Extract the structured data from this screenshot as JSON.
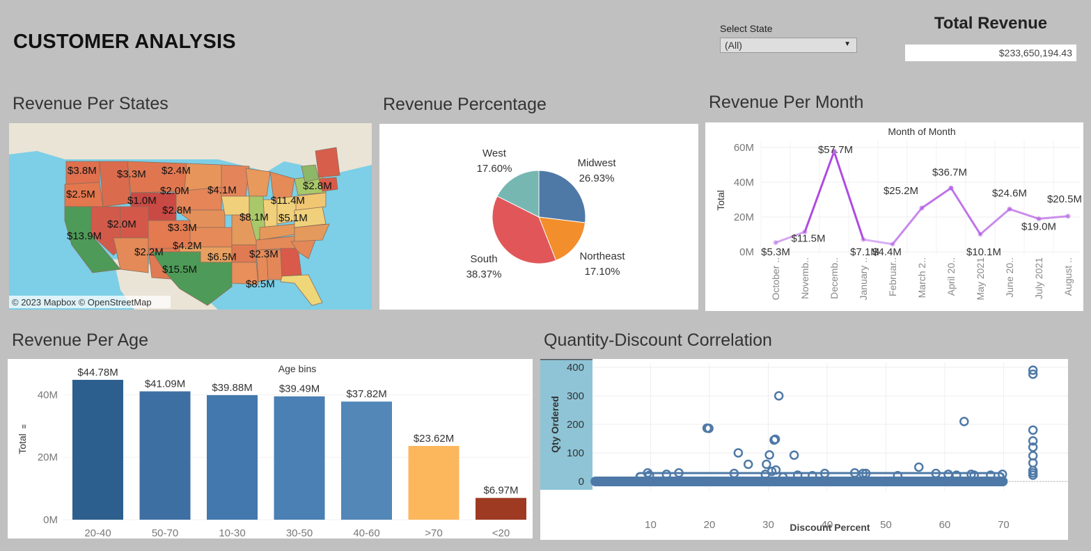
{
  "header": {
    "title": "CUSTOMER ANALYSIS"
  },
  "filter": {
    "label": "Select State",
    "value": "(All)"
  },
  "kpi": {
    "title": "Total Revenue",
    "value": "$233,650,194.43"
  },
  "sections": {
    "states": "Revenue Per States",
    "percentage": "Revenue Percentage",
    "month": "Revenue Per Month",
    "age": "Revenue Per Age",
    "discount": "Quantity-Discount Correlation"
  },
  "map": {
    "attribution": "© 2023 Mapbox  © OpenStreetMap",
    "labels": [
      "$3.8M",
      "$3.3M",
      "$2.4M",
      "$2.5M",
      "$2.0M",
      "$1.0M",
      "$4.1M",
      "$2.8M",
      "$2.8M",
      "$11.4M",
      "$2.0M",
      "$3.3M",
      "$8.1M",
      "$5.1M",
      "$13.9M",
      "$4.2M",
      "$2.2M",
      "$6.5M",
      "$2.3M",
      "$15.5M",
      "$8.5M"
    ],
    "colors": {
      "high": "#4e9a58",
      "mid": "#efd679",
      "low": "#d9574a"
    }
  },
  "chart_data": [
    {
      "type": "pie",
      "labels": [
        "Midwest",
        "Northeast",
        "South",
        "West"
      ],
      "values": [
        26.93,
        17.1,
        38.37,
        17.6
      ],
      "value_labels": [
        "26.93%",
        "17.10%",
        "38.37%",
        "17.60%"
      ],
      "colors": [
        "#4e79a7",
        "#f28e2b",
        "#e15759",
        "#76b7b2"
      ]
    },
    {
      "type": "line",
      "title": "Month of Month",
      "ylabel": "Total",
      "categories": [
        "October ..",
        "Novemb..",
        "Decemb..",
        "January ..",
        "Februar..",
        "March 2..",
        "April 20..",
        "May 2021",
        "June 20..",
        "July 2021",
        "August .."
      ],
      "values": [
        5.3,
        11.5,
        57.7,
        7.1,
        4.4,
        25.2,
        36.7,
        10.1,
        24.6,
        19.0,
        20.5
      ],
      "value_labels": [
        "$5.3M",
        "$11.5M",
        "$57.7M",
        "$7.1M",
        "$4.4M",
        "$25.2M",
        "$36.7M",
        "$10.1M",
        "$24.6M",
        "$19.0M",
        "$20.5M"
      ],
      "ylim": [
        0,
        60
      ],
      "yticks": [
        "0M",
        "20M",
        "40M",
        "60M"
      ],
      "grid": true
    },
    {
      "type": "bar",
      "title": "Age bins",
      "ylabel": "Total",
      "categories": [
        "20-40",
        "50-70",
        "10-30",
        "30-50",
        "40-60",
        ">70",
        "<20"
      ],
      "values": [
        44.78,
        41.09,
        39.88,
        39.49,
        37.82,
        23.62,
        6.97
      ],
      "value_labels": [
        "$44.78M",
        "$41.09M",
        "$39.88M",
        "$39.49M",
        "$37.82M",
        "$23.62M",
        "$6.97M"
      ],
      "colors": [
        "#2d5f8e",
        "#3d6fa2",
        "#4278ad",
        "#4a80b4",
        "#5287b8",
        "#fcb75c",
        "#9e3a22"
      ],
      "ylim": [
        0,
        47
      ],
      "yticks": [
        "0M",
        "20M",
        "40M"
      ]
    },
    {
      "type": "scatter",
      "xlabel": "Discount Percent",
      "ylabel": "Qty Ordered",
      "xlim": [
        0,
        78
      ],
      "ylim": [
        -10,
        410
      ],
      "xticks": [
        "10",
        "20",
        "30",
        "40",
        "50",
        "60",
        "70"
      ],
      "yticks": [
        "0",
        "100",
        "200",
        "300",
        "400"
      ],
      "points": [
        [
          9.5,
          30
        ],
        [
          9.8,
          22
        ],
        [
          12.7,
          25
        ],
        [
          14.8,
          30
        ],
        [
          19.6,
          187
        ],
        [
          19.9,
          186
        ],
        [
          24.2,
          28
        ],
        [
          24.9,
          100
        ],
        [
          26.6,
          60
        ],
        [
          29.5,
          25
        ],
        [
          29.7,
          60
        ],
        [
          30.2,
          93
        ],
        [
          30.6,
          35
        ],
        [
          31,
          145
        ],
        [
          31.2,
          148
        ],
        [
          31.3,
          40
        ],
        [
          31.8,
          300
        ],
        [
          32.5,
          15
        ],
        [
          34.4,
          92
        ],
        [
          35,
          22
        ],
        [
          37.5,
          20
        ],
        [
          39.6,
          28
        ],
        [
          44.7,
          30
        ],
        [
          46.1,
          28
        ],
        [
          46.6,
          28
        ],
        [
          52,
          20
        ],
        [
          55.6,
          50
        ],
        [
          58.5,
          28
        ],
        [
          60.6,
          25
        ],
        [
          62,
          22
        ],
        [
          63.3,
          210
        ],
        [
          64.5,
          25
        ],
        [
          65,
          22
        ],
        [
          67.8,
          22
        ],
        [
          69.8,
          25
        ],
        [
          75,
          390
        ],
        [
          75,
          376
        ],
        [
          75,
          180
        ],
        [
          75,
          142
        ],
        [
          75,
          120
        ],
        [
          75,
          90
        ],
        [
          75,
          65
        ],
        [
          75,
          38
        ],
        [
          75,
          30
        ],
        [
          75,
          22
        ]
      ],
      "band_start": 0.5,
      "band_end": 70
    }
  ]
}
